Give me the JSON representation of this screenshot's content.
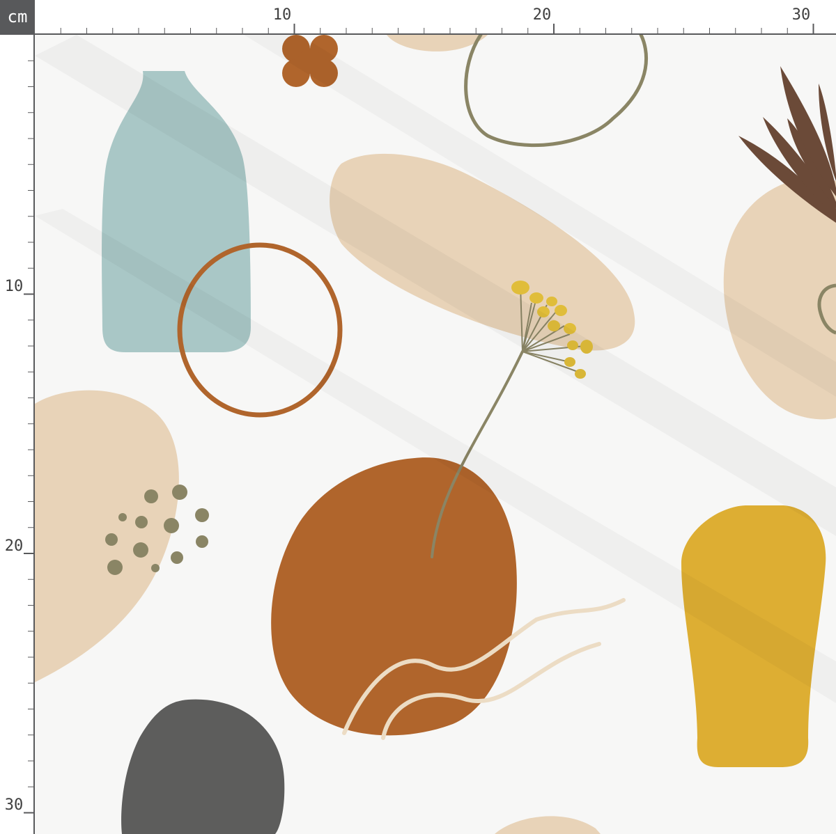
{
  "ruler": {
    "unit_label": "cm",
    "top_labels": [
      "10",
      "20",
      "30"
    ],
    "left_labels": [
      "10",
      "20",
      "30"
    ]
  },
  "colors": {
    "background": "#f7f7f6",
    "ruler_dark": "#58595b",
    "sand": "#e8d3b8",
    "sage_blue": "#a9c7c6",
    "rust": "#b0652c",
    "mustard": "#ddae33",
    "charcoal": "#5d5d5c",
    "olive": "#8a8565",
    "brown_leaf": "#6b4a38"
  },
  "fabric": {
    "pattern_name": "",
    "motifs": [
      "bottle-vase",
      "ring",
      "pebble",
      "dandelion-flower",
      "dots",
      "flower",
      "leaf-sprig",
      "mustard-vase",
      "loop-line",
      "wavy-lines"
    ]
  }
}
